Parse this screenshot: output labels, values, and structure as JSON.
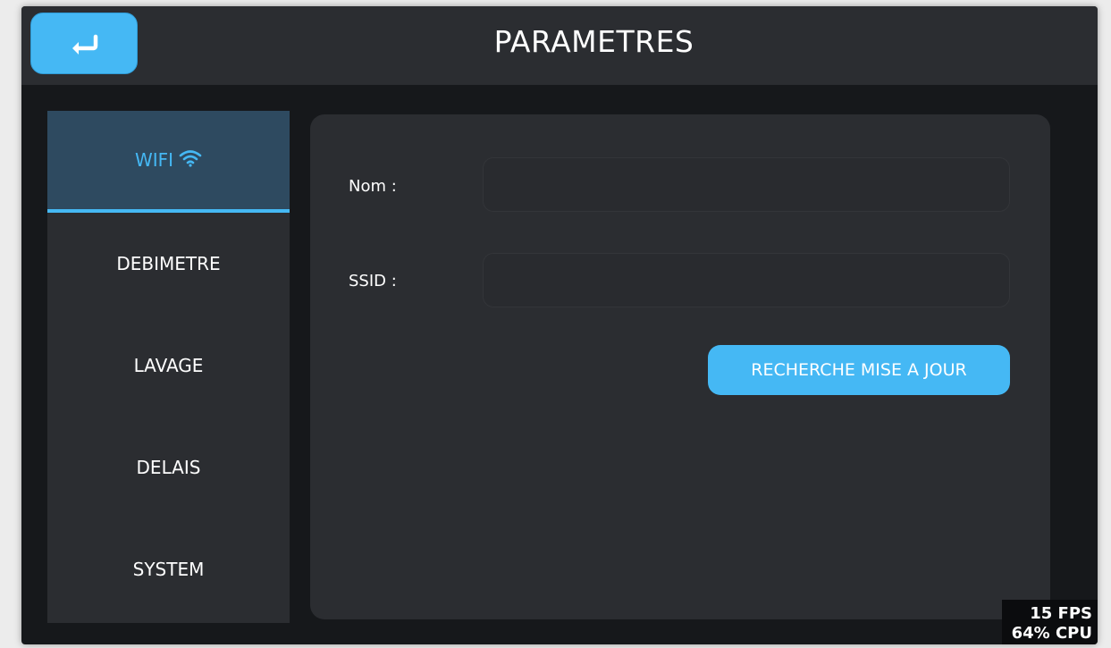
{
  "header": {
    "title": "PARAMETRES",
    "back_icon": "return-arrow-icon"
  },
  "sidebar": {
    "items": [
      {
        "label": "WIFI",
        "icon": "wifi-icon",
        "active": true
      },
      {
        "label": "DEBIMETRE",
        "active": false
      },
      {
        "label": "LAVAGE",
        "active": false
      },
      {
        "label": "DELAIS",
        "active": false
      },
      {
        "label": "SYSTEM",
        "active": false
      }
    ]
  },
  "wifi_panel": {
    "name_label": "Nom :",
    "name_value": "",
    "ssid_label": "SSID :",
    "ssid_value": "",
    "update_button": "RECHERCHE MISE A JOUR"
  },
  "status": {
    "fps": "15 FPS",
    "cpu": "64% CPU"
  },
  "colors": {
    "accent": "#45b8f4",
    "background": "#16181b",
    "panel": "#2b2d31",
    "active_nav": "#2e4a60"
  }
}
